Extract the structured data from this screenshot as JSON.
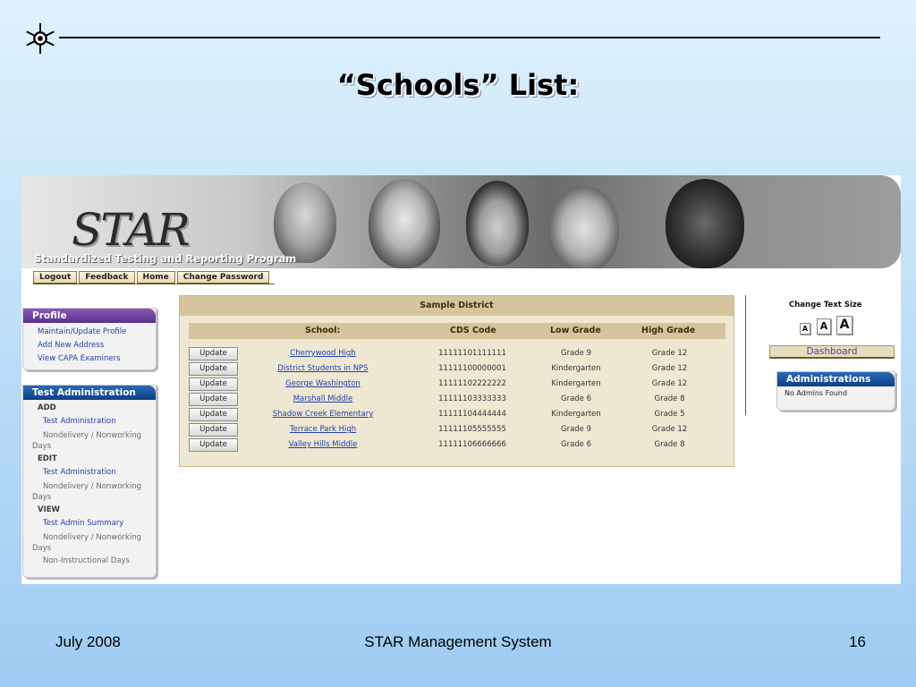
{
  "slide": {
    "title": "“Schools” List:",
    "footer_left": "July 2008",
    "footer_center": "STAR Management System",
    "footer_right": "16"
  },
  "app": {
    "logo_text": "STAR",
    "tagline": "Standardized Testing and Reporting Program",
    "nav_tabs": [
      "Logout",
      "Feedback",
      "Home",
      "Change Password"
    ]
  },
  "profile_panel": {
    "title": "Profile",
    "items": [
      "Maintain/Update Profile",
      "Add New Address",
      "View CAPA Examiners"
    ]
  },
  "test_admin_panel": {
    "title": "Test Administration",
    "add_label": "ADD",
    "add_items": [
      "Test Administration",
      "Nondelivery / Nonworking Days"
    ],
    "edit_label": "EDIT",
    "edit_items": [
      "Test Administration",
      "Nondelivery / Nonworking Days"
    ],
    "view_label": "VIEW",
    "view_items": [
      "Test Admin Summary",
      "Nondelivery / Nonworking Days",
      "Non-Instructional Days"
    ]
  },
  "schools_table": {
    "district": "Sample District",
    "headers": [
      "School:",
      "CDS Code",
      "Low Grade",
      "High Grade"
    ],
    "update_label": "Update",
    "rows": [
      {
        "school": "Cherrywood High",
        "cds": "11111101111111",
        "low": "Grade 9",
        "high": "Grade 12"
      },
      {
        "school": "District Students in NPS",
        "cds": "11111100000001",
        "low": "Kindergarten",
        "high": "Grade 12"
      },
      {
        "school": "George Washington",
        "cds": "11111102222222",
        "low": "Kindergarten",
        "high": "Grade 12"
      },
      {
        "school": "Marshall Middle",
        "cds": "11111103333333",
        "low": "Grade 6",
        "high": "Grade 8"
      },
      {
        "school": "Shadow Creek Elementary",
        "cds": "11111104444444",
        "low": "Kindergarten",
        "high": "Grade 5"
      },
      {
        "school": "Terrace Park High",
        "cds": "11111105555555",
        "low": "Grade 9",
        "high": "Grade 12"
      },
      {
        "school": "Valley Hills Middle",
        "cds": "11111106666666",
        "low": "Grade 6",
        "high": "Grade 8"
      }
    ]
  },
  "right_panel": {
    "text_size_label": "Change Text Size",
    "size_buttons": [
      "A",
      "A",
      "A"
    ],
    "dashboard_label": "Dashboard",
    "admin_title": "Administrations",
    "admin_note": "No Admins Found"
  },
  "colors": {
    "profile_header": "#55338a",
    "test_admin_header": "#0f3f85",
    "table_header": "#d5c49c",
    "link": "#2341a8"
  }
}
